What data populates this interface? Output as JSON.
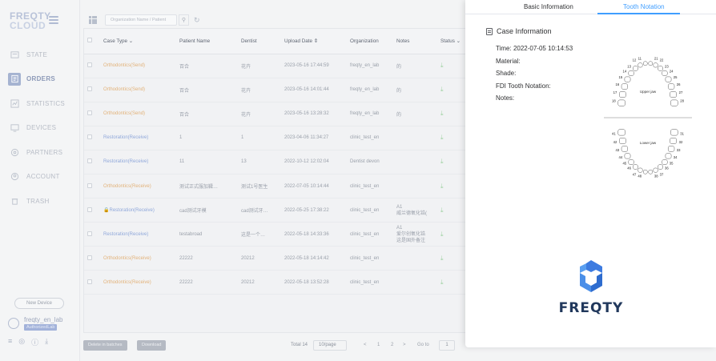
{
  "app": {
    "logo_line1": "FREQTY",
    "logo_line2": "CLOUD"
  },
  "sidebar": {
    "items": [
      {
        "label": "STATE",
        "icon": "state-icon"
      },
      {
        "label": "ORDERS",
        "icon": "orders-icon",
        "active": true
      },
      {
        "label": "STATISTICS",
        "icon": "statistics-icon"
      },
      {
        "label": "DEVICES",
        "icon": "devices-icon"
      },
      {
        "label": "PARTNERS",
        "icon": "partners-icon"
      },
      {
        "label": "ACCOUNT",
        "icon": "account-icon"
      },
      {
        "label": "TRASH",
        "icon": "trash-icon"
      }
    ],
    "new_device": "New Device",
    "user_name": "freqty_en_lab",
    "user_role": "AuthorizedLab"
  },
  "toolbar": {
    "search_placeholder": "Organization Name / Patient"
  },
  "table": {
    "headers": [
      "Case Type",
      "Patient Name",
      "Dentist",
      "Upload Date",
      "Organization",
      "Notes",
      "Status"
    ],
    "rows": [
      {
        "case_type": "Orthodontics(Send)",
        "kind": "ortho",
        "patient": "百合",
        "dentist": "花卉",
        "date": "2023-05-16 17:44:59",
        "org": "freqty_en_lab",
        "notes": "的",
        "status": "download"
      },
      {
        "case_type": "Orthodontics(Send)",
        "kind": "ortho",
        "patient": "百合",
        "dentist": "花卉",
        "date": "2023-05-16 14:01:44",
        "org": "freqty_en_lab",
        "notes": "的",
        "status": "download"
      },
      {
        "case_type": "Orthodontics(Send)",
        "kind": "ortho",
        "patient": "百合",
        "dentist": "花卉",
        "date": "2023-05-16 13:28:32",
        "org": "freqty_en_lab",
        "notes": "的",
        "status": "download"
      },
      {
        "case_type": "Restoration(Receive)",
        "kind": "resto",
        "patient": "1",
        "dentist": "1",
        "date": "2023-04-06 11:34:27",
        "org": "clinic_test_en",
        "notes": "",
        "status": "download"
      },
      {
        "case_type": "Restoration(Receive)",
        "kind": "resto",
        "patient": "11",
        "dentist": "13",
        "date": "2022-10-12 12:02:04",
        "org": "Dentist devon",
        "notes": "",
        "status": "download"
      },
      {
        "case_type": "Orthodontics(Receive)",
        "kind": "ortho",
        "patient": "测试正式服加鞣…",
        "dentist": "测试1号医生",
        "date": "2022-07-05 10:14:44",
        "org": "clinic_test_en",
        "notes": "",
        "status": "download"
      },
      {
        "case_type": "Restoration(Receive)",
        "kind": "resto",
        "locked": true,
        "patient": "cad测试牙模",
        "dentist": "cad测试牙…",
        "date": "2022-05-25 17:38:22",
        "org": "clinic_test_en",
        "notes": "A1",
        "notes2": "威兰德氧化锆(",
        "status": "download"
      },
      {
        "case_type": "Restoration(Receive)",
        "kind": "resto",
        "patient": "testabroad",
        "dentist": "这是一个…",
        "date": "2022-05-18 14:33:36",
        "org": "clinic_test_en",
        "notes": "A1",
        "notes2": "爱尔创氧化锆",
        "notes3": "这是国外备注",
        "status": "download"
      },
      {
        "case_type": "Orthodontics(Receive)",
        "kind": "ortho",
        "patient": "22222",
        "dentist": "20212",
        "date": "2022-05-18 14:14:42",
        "org": "clinic_test_en",
        "notes": "",
        "status": "download"
      },
      {
        "case_type": "Orthodontics(Receive)",
        "kind": "ortho",
        "patient": "22222",
        "dentist": "20212",
        "date": "2022-05-18 13:52:28",
        "org": "clinic_test_en",
        "notes": "",
        "status": "download"
      }
    ]
  },
  "pager": {
    "delete_batches": "Delete in batches",
    "download": "Download",
    "total": "Total 14",
    "page_size": "10/page",
    "prev": "<",
    "page1": "1",
    "page2": "2",
    "next": ">",
    "goto_label": "Go to",
    "goto_value": "1"
  },
  "panel": {
    "tab_basic": "Basic Information",
    "tab_tooth": "Tooth Notation",
    "case_title": "Case Information",
    "time_label": "Time:",
    "time_value": "2022-07-05 10:14:53",
    "material_label": "Material:",
    "shade_label": "Shade:",
    "fdi_label": "FDI Tooth Notation:",
    "notes_label": "Notes:",
    "upper_jaw": "Upper jaw",
    "lower_jaw": "Lower jaw",
    "brand": "FREQTY",
    "upper_numbers": [
      "11",
      "21",
      "12",
      "22",
      "13",
      "23",
      "14",
      "24",
      "15",
      "25",
      "16",
      "26",
      "17",
      "27",
      "18",
      "28"
    ],
    "lower_numbers": [
      "48",
      "38",
      "47",
      "37",
      "46",
      "36",
      "45",
      "35",
      "44",
      "34",
      "43",
      "33",
      "42",
      "32",
      "41",
      "31"
    ]
  }
}
